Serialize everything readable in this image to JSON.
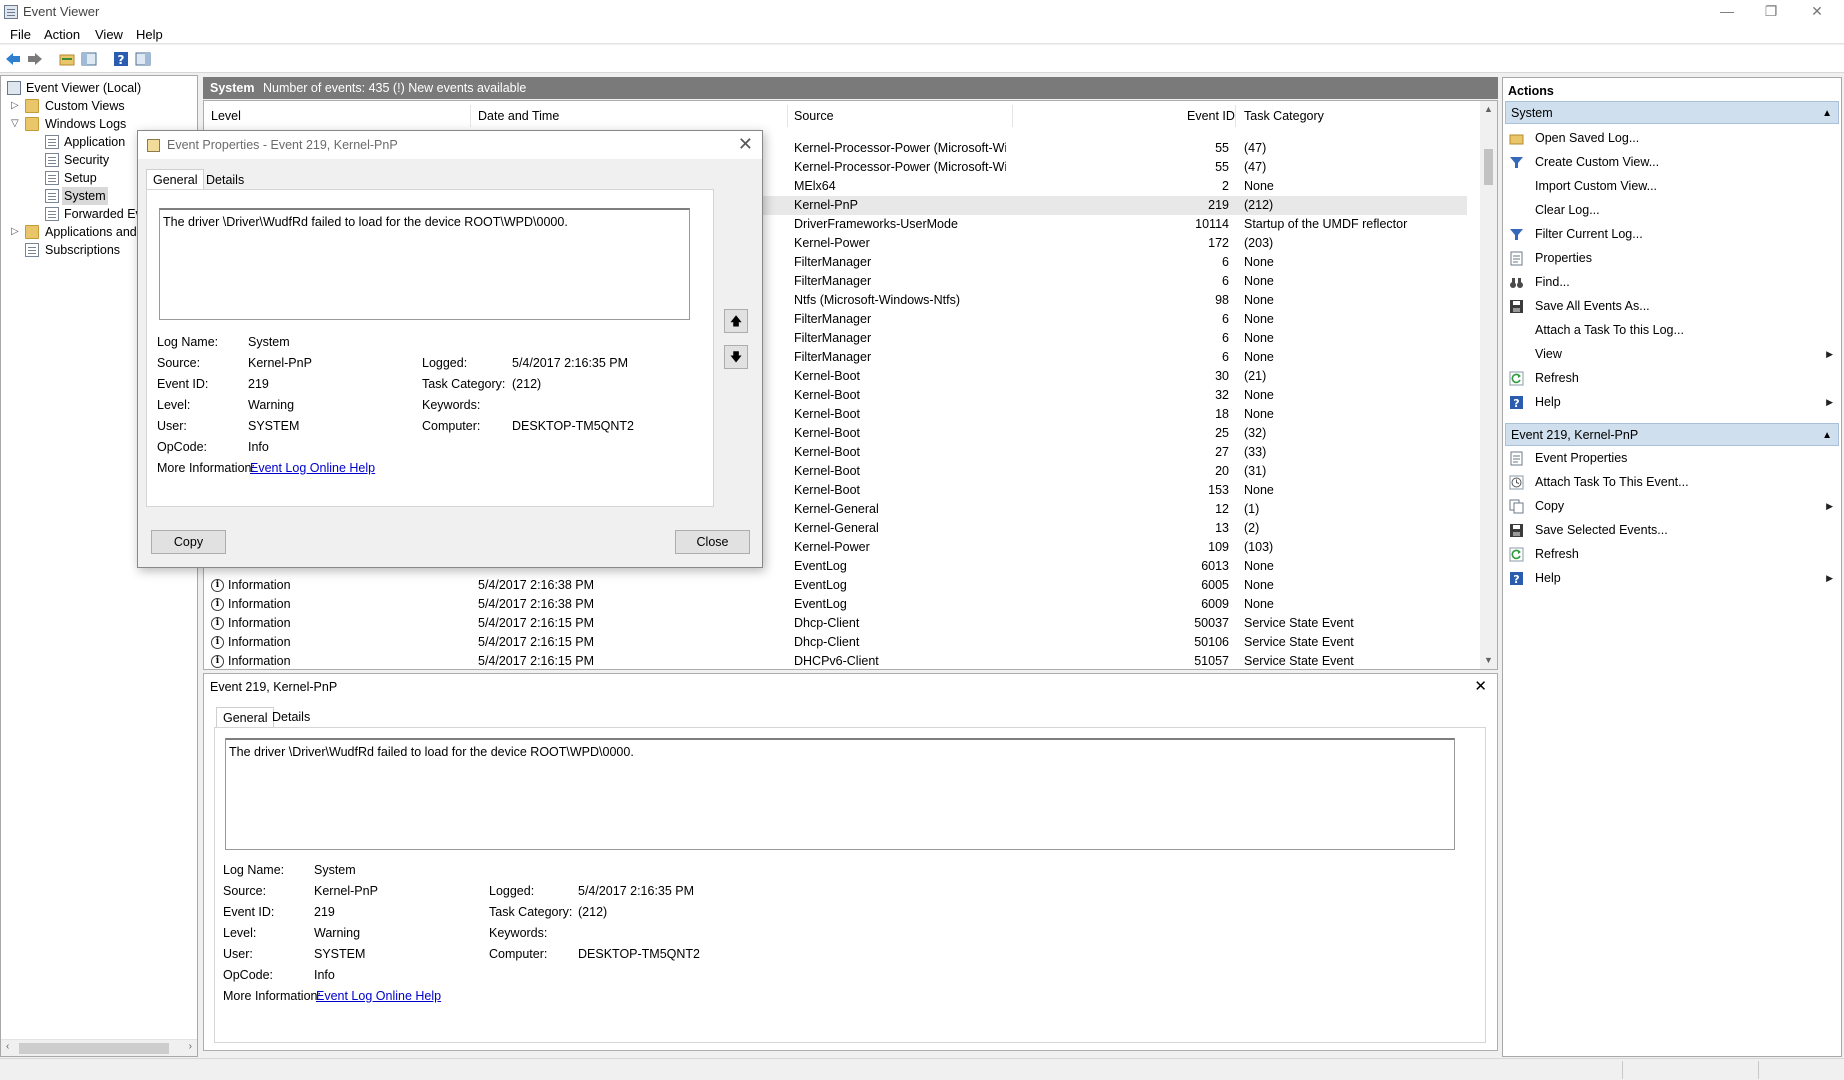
{
  "window": {
    "title": "Event Viewer"
  },
  "menu": [
    "File",
    "Action",
    "View",
    "Help"
  ],
  "toolbar": {
    "icons": [
      "back-arrow-icon",
      "forward-arrow-icon",
      "open-folder-icon",
      "show-scope-icon",
      "help-icon",
      "action-pane-icon"
    ]
  },
  "tree": {
    "items": [
      {
        "label": "Event Viewer (Local)",
        "level": 0,
        "expander": ""
      },
      {
        "label": "Custom Views",
        "level": 1,
        "expander": "▷"
      },
      {
        "label": "Windows Logs",
        "level": 1,
        "expander": "▽"
      },
      {
        "label": "Application",
        "level": 2,
        "expander": ""
      },
      {
        "label": "Security",
        "level": 2,
        "expander": ""
      },
      {
        "label": "Setup",
        "level": 2,
        "expander": ""
      },
      {
        "label": "System",
        "level": 2,
        "expander": ""
      },
      {
        "label": "Forwarded Eve",
        "level": 2,
        "expander": ""
      },
      {
        "label": "Applications and",
        "level": 1,
        "expander": "▷"
      },
      {
        "label": "Subscriptions",
        "level": 1,
        "expander": ""
      }
    ]
  },
  "log": {
    "name": "System",
    "count_text": "Number of events: 435 (!) New events available",
    "columns": [
      "Level",
      "Date and Time",
      "Source",
      "Event ID",
      "Task Category"
    ],
    "rows": [
      {
        "level": "",
        "date": "",
        "source": "Kernel-Processor-Power (Microsoft-Wi...",
        "id": "55",
        "task": "(47)"
      },
      {
        "level": "",
        "date": "",
        "source": "Kernel-Processor-Power (Microsoft-Wi...",
        "id": "55",
        "task": "(47)"
      },
      {
        "level": "",
        "date": "",
        "source": "MElx64",
        "id": "2",
        "task": "None"
      },
      {
        "level": "",
        "date": "",
        "source": "Kernel-PnP",
        "id": "219",
        "task": "(212)"
      },
      {
        "level": "",
        "date": "",
        "source": "DriverFrameworks-UserMode",
        "id": "10114",
        "task": "Startup of the UMDF reflector"
      },
      {
        "level": "",
        "date": "",
        "source": "Kernel-Power",
        "id": "172",
        "task": "(203)"
      },
      {
        "level": "",
        "date": "",
        "source": "FilterManager",
        "id": "6",
        "task": "None"
      },
      {
        "level": "",
        "date": "",
        "source": "FilterManager",
        "id": "6",
        "task": "None"
      },
      {
        "level": "",
        "date": "",
        "source": "Ntfs (Microsoft-Windows-Ntfs)",
        "id": "98",
        "task": "None"
      },
      {
        "level": "",
        "date": "",
        "source": "FilterManager",
        "id": "6",
        "task": "None"
      },
      {
        "level": "",
        "date": "",
        "source": "FilterManager",
        "id": "6",
        "task": "None"
      },
      {
        "level": "",
        "date": "",
        "source": "FilterManager",
        "id": "6",
        "task": "None"
      },
      {
        "level": "",
        "date": "",
        "source": "Kernel-Boot",
        "id": "30",
        "task": "(21)"
      },
      {
        "level": "",
        "date": "",
        "source": "Kernel-Boot",
        "id": "32",
        "task": "None"
      },
      {
        "level": "",
        "date": "",
        "source": "Kernel-Boot",
        "id": "18",
        "task": "None"
      },
      {
        "level": "",
        "date": "",
        "source": "Kernel-Boot",
        "id": "25",
        "task": "(32)"
      },
      {
        "level": "",
        "date": "",
        "source": "Kernel-Boot",
        "id": "27",
        "task": "(33)"
      },
      {
        "level": "",
        "date": "",
        "source": "Kernel-Boot",
        "id": "20",
        "task": "(31)"
      },
      {
        "level": "",
        "date": "",
        "source": "Kernel-Boot",
        "id": "153",
        "task": "None"
      },
      {
        "level": "",
        "date": "",
        "source": "Kernel-General",
        "id": "12",
        "task": "(1)"
      },
      {
        "level": "",
        "date": "",
        "source": "Kernel-General",
        "id": "13",
        "task": "(2)"
      },
      {
        "level": "",
        "date": "",
        "source": "Kernel-Power",
        "id": "109",
        "task": "(103)"
      },
      {
        "level": "",
        "date": "",
        "source": "EventLog",
        "id": "6013",
        "task": "None"
      },
      {
        "level": "Information",
        "date": "5/4/2017 2:16:38 PM",
        "source": "EventLog",
        "id": "6005",
        "task": "None"
      },
      {
        "level": "Information",
        "date": "5/4/2017 2:16:38 PM",
        "source": "EventLog",
        "id": "6009",
        "task": "None"
      },
      {
        "level": "Information",
        "date": "5/4/2017 2:16:15 PM",
        "source": "Dhcp-Client",
        "id": "50037",
        "task": "Service State Event"
      },
      {
        "level": "Information",
        "date": "5/4/2017 2:16:15 PM",
        "source": "Dhcp-Client",
        "id": "50106",
        "task": "Service State Event"
      },
      {
        "level": "Information",
        "date": "5/4/2017 2:16:15 PM",
        "source": "DHCPv6-Client",
        "id": "51057",
        "task": "Service State Event"
      },
      {
        "level": "Information",
        "date": "5/4/2017 2:16:15 PM",
        "source": "DHCPv6-Client",
        "id": "51057",
        "task": "Service State Event"
      }
    ]
  },
  "event": {
    "title": "Event 219, Kernel-PnP",
    "tabs": [
      "General",
      "Details"
    ],
    "description": "The driver \\Driver\\WudfRd failed to load for the device ROOT\\WPD\\0000.",
    "labels": {
      "log_name": "Log Name:",
      "source": "Source:",
      "event_id": "Event ID:",
      "level": "Level:",
      "user": "User:",
      "opcode": "OpCode:",
      "more_info": "More Information:",
      "logged": "Logged:",
      "task_category": "Task Category:",
      "keywords": "Keywords:",
      "computer": "Computer:"
    },
    "values": {
      "log_name": "System",
      "source": "Kernel-PnP",
      "event_id": "219",
      "level": "Warning",
      "user": "SYSTEM",
      "opcode": "Info",
      "more_info_link": "Event Log Online Help",
      "logged": "5/4/2017 2:16:35 PM",
      "task_category": "(212)",
      "keywords": "",
      "computer": "DESKTOP-TM5QNT2"
    }
  },
  "dialog": {
    "title": "Event Properties - Event 219, Kernel-PnP",
    "copy_label": "Copy",
    "close_label": "Close"
  },
  "actions": {
    "header": "Actions",
    "sections": [
      {
        "title": "System",
        "items": [
          {
            "label": "Open Saved Log...",
            "icon": "open-folder-icon",
            "submenu": false
          },
          {
            "label": "Create Custom View...",
            "icon": "filter-icon",
            "submenu": false
          },
          {
            "label": "Import Custom View...",
            "icon": "",
            "submenu": false
          },
          {
            "label": "Clear Log...",
            "icon": "",
            "submenu": false
          },
          {
            "label": "Filter Current Log...",
            "icon": "filter-icon",
            "submenu": false
          },
          {
            "label": "Properties",
            "icon": "properties-icon",
            "submenu": false
          },
          {
            "label": "Find...",
            "icon": "binoculars-icon",
            "submenu": false
          },
          {
            "label": "Save All Events As...",
            "icon": "save-icon",
            "submenu": false
          },
          {
            "label": "Attach a Task To this Log...",
            "icon": "",
            "submenu": false
          },
          {
            "label": "View",
            "icon": "",
            "submenu": true
          },
          {
            "label": "Refresh",
            "icon": "refresh-icon",
            "submenu": false
          },
          {
            "label": "Help",
            "icon": "help-icon",
            "submenu": true
          }
        ]
      },
      {
        "title": "Event 219, Kernel-PnP",
        "items": [
          {
            "label": "Event Properties",
            "icon": "properties-icon",
            "submenu": false
          },
          {
            "label": "Attach Task To This Event...",
            "icon": "clock-icon",
            "submenu": false
          },
          {
            "label": "Copy",
            "icon": "copy-icon",
            "submenu": true
          },
          {
            "label": "Save Selected Events...",
            "icon": "save-icon",
            "submenu": false
          },
          {
            "label": "Refresh",
            "icon": "refresh-icon",
            "submenu": false
          },
          {
            "label": "Help",
            "icon": "help-icon",
            "submenu": true
          }
        ]
      }
    ]
  },
  "colors": {
    "accent": "#cfdfee",
    "header_bar": "#7a7a7a",
    "link": "#0000cc"
  }
}
